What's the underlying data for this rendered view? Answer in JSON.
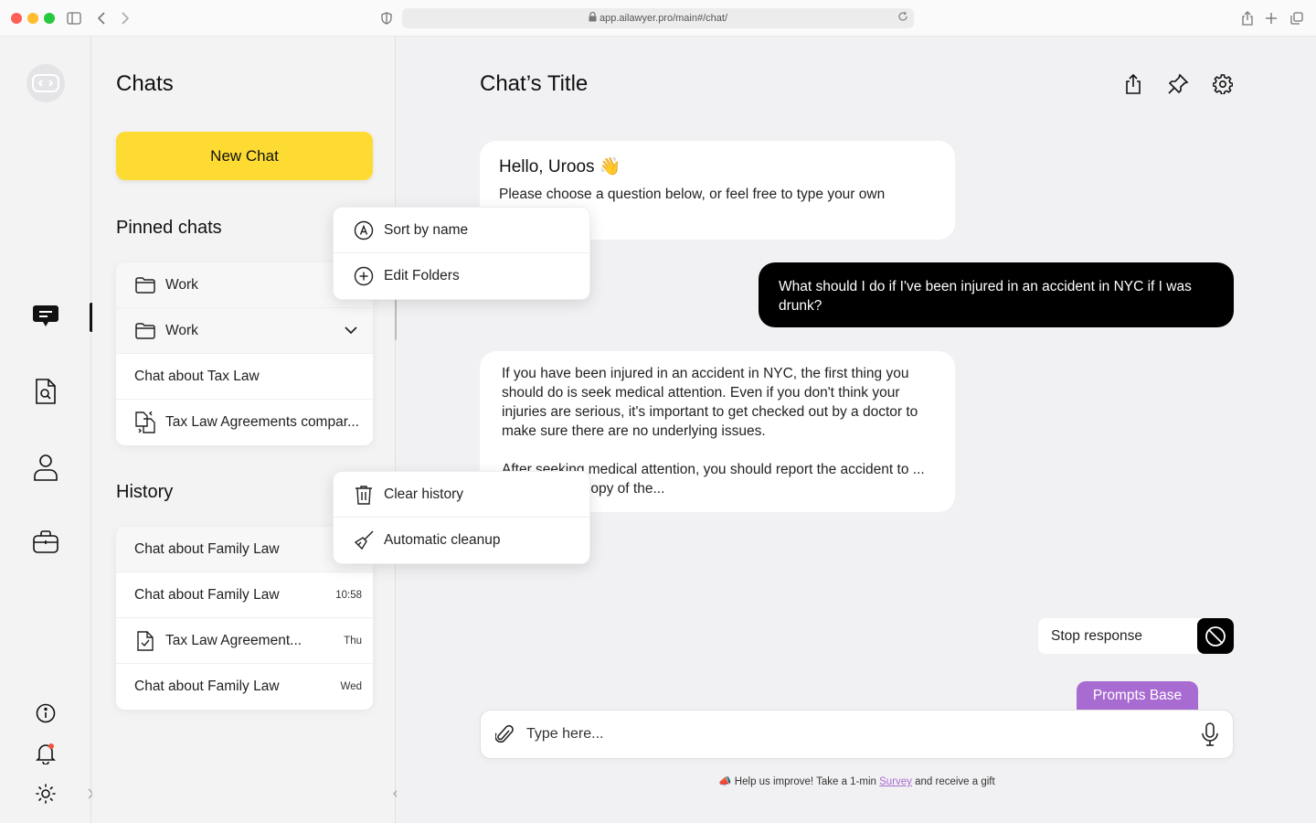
{
  "browser": {
    "url": "app.ailawyer.pro/main#/chat/"
  },
  "chats_panel": {
    "title": "Chats",
    "new_chat_label": "New Chat",
    "pinned_title": "Pinned chats",
    "pinned": [
      {
        "label": "Work",
        "icon": "folder-icon"
      },
      {
        "label": "Work",
        "icon": "folder-icon"
      },
      {
        "label": "Chat about Tax Law",
        "icon": ""
      },
      {
        "label": "Tax Law Agreements compar...",
        "icon": "compare-doc-icon"
      }
    ],
    "history_title": "History",
    "history": [
      {
        "label": "Chat about Family Law",
        "time": ""
      },
      {
        "label": "Chat about Family Law",
        "time": "10:58"
      },
      {
        "label": "Tax Law Agreement...",
        "time": "Thu"
      },
      {
        "label": "Chat about Family Law",
        "time": "Wed"
      }
    ]
  },
  "pinned_menu": {
    "items": [
      "Sort by name",
      "Edit Folders"
    ]
  },
  "history_menu": {
    "items": [
      "Clear history",
      "Automatic cleanup"
    ]
  },
  "chat": {
    "title": "Chat’s Title",
    "greeting_title": "Hello, Uroos 👋",
    "greeting_sub": "Please choose a question below, or feel free to type your own",
    "user_message": "What should I do if I've been injured in an accident in NYC if I was drunk?",
    "answer_p1": "If you have been injured in an accident in NYC, the first thing you should do is seek medical attention. Even if you don't think your injuries are serious, it's important to get checked out by a doctor to make sure there are no underlying issues.",
    "answer_p2": "After seeking medical attention, you should report the accident to ... and obtain a copy of the...",
    "stop_label": "Stop response",
    "prompts_tab": "Prompts Base",
    "input_placeholder": "Type here...",
    "footer_prefix": "📣 Help us improve! Take a 1-min ",
    "footer_link": "Survey",
    "footer_suffix": " and receive a gift"
  },
  "colors": {
    "accent_yellow": "#fedb32",
    "accent_purple": "#a86bd1",
    "user_bubble": "#000000"
  }
}
